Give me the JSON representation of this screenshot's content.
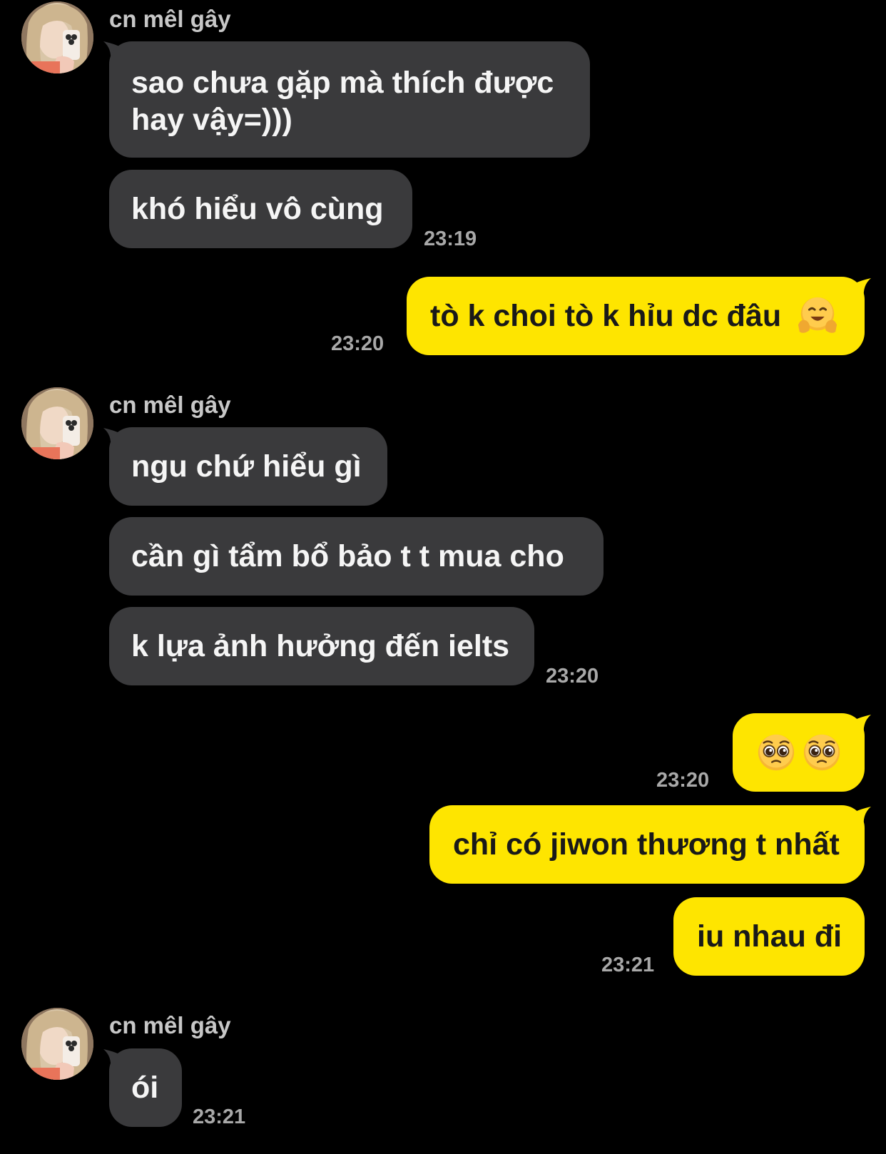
{
  "colors": {
    "background": "#000000",
    "incoming_bubble": "#3a3a3c",
    "outgoing_bubble": "#fee500",
    "sender_name": "#c7c7c7",
    "timestamp": "#a8a8a8"
  },
  "groups": [
    {
      "sender": "cn mêl gây",
      "messages": [
        "sao chưa gặp mà thích được hay vậy=)))",
        "khó hiểu vô cùng"
      ],
      "time": "23:19"
    },
    {
      "outgoing": true,
      "messages": [
        "tò k choi tò k hỉu dc đâu"
      ],
      "emoji": "smiling-face-with-open-hands-emoji",
      "time": "23:20"
    },
    {
      "sender": "cn mêl gây",
      "messages": [
        "ngu chứ hiểu gì",
        "cần gì tẩm bổ bảo t t mua cho",
        "k lựa ảnh hưởng đến ielts"
      ],
      "time": "23:20"
    },
    {
      "outgoing": true,
      "emoji_message": [
        "pleading-face-emoji",
        "pleading-face-emoji"
      ],
      "time": "23:20"
    },
    {
      "outgoing": true,
      "messages": [
        "chỉ có jiwon thương t nhất",
        "iu nhau đi"
      ],
      "time": "23:21"
    },
    {
      "sender": "cn mêl gây",
      "messages": [
        "ói"
      ],
      "time": "23:21"
    }
  ]
}
